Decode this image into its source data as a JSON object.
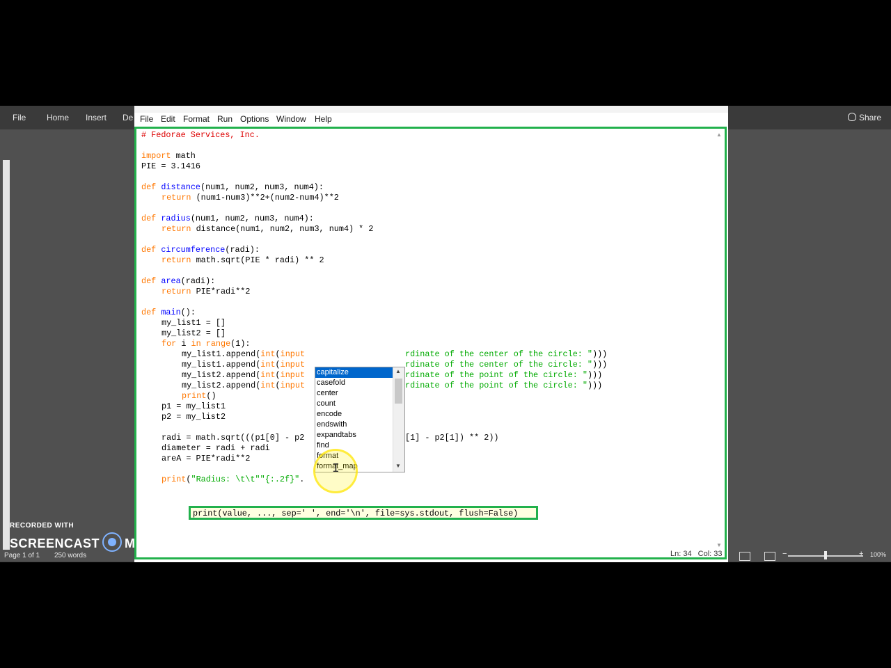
{
  "word": {
    "tabs": [
      "File",
      "Home",
      "Insert",
      "De"
    ],
    "share_label": "Share",
    "status": {
      "page": "Page 1 of 1",
      "words": "250 words"
    },
    "zoom_label": "100%",
    "watermark": {
      "line1": "RECORDED WITH",
      "brand_left": "SCREENCAST",
      "brand_right": "MATIC"
    }
  },
  "idle": {
    "menu": [
      "File",
      "Edit",
      "Format",
      "Run",
      "Options",
      "Window",
      "Help"
    ],
    "status": {
      "line": "Ln: 34",
      "col": "Col: 33"
    },
    "code": {
      "l1": "# Fedorae Services, Inc.",
      "l2_kw": "import",
      "l2_rest": " math",
      "l3": "PIE = 3.1416",
      "l4_kw": "def",
      "l4_fn": "distance",
      "l4_rest": "(num1, num2, num3, num4):",
      "l5_kw": "return",
      "l5_rest": " (num1-num3)**2+(num2-num4)**2",
      "l6_kw": "def",
      "l6_fn": "radius",
      "l6_rest": "(num1, num2, num3, num4):",
      "l7_kw": "return",
      "l7_rest": " distance(num1, num2, num3, num4) * 2",
      "l8_kw": "def",
      "l8_fn": "circumference",
      "l8_rest": "(radi):",
      "l9_kw": "return",
      "l9_rest": " math.sqrt(PIE * radi) ** 2",
      "l10_kw": "def",
      "l10_fn": "area",
      "l10_rest": "(radi):",
      "l11_kw": "return",
      "l11_rest": " PIE*radi**2",
      "l12_kw": "def",
      "l12_fn": "main",
      "l12_rest": "():",
      "l13": "my_list1 = []",
      "l14": "my_list2 = []",
      "l15_kw": "for",
      "l15_a": " i ",
      "l15_kw2": "in",
      "l15_b": " ",
      "l15_bi": "range",
      "l15_c": "(1):",
      "l16_a": "my_list1.append(",
      "l16_bi": "int",
      "l16_b": "(",
      "l16_bi2": "input",
      "l16_str": "rdinate of the center of the circle: \"",
      "l16_end": ")))",
      "l17_a": "my_list1.append(",
      "l17_bi": "int",
      "l17_b": "(",
      "l17_bi2": "input",
      "l17_str": "rdinate of the center of the circle: \"",
      "l17_end": ")))",
      "l18_a": "my_list2.append(",
      "l18_bi": "int",
      "l18_b": "(",
      "l18_bi2": "input",
      "l18_str": "rdinate of the point of the circle: \"",
      "l18_end": ")))",
      "l19_a": "my_list2.append(",
      "l19_bi": "int",
      "l19_b": "(",
      "l19_bi2": "input",
      "l19_str": "rdinate of the point of the circle: \"",
      "l19_end": ")))",
      "l20_bi": "print",
      "l20_rest": "()",
      "l21": "p1 = my_list1",
      "l22": "p2 = my_list2",
      "l23_a": "radi = math.sqrt(((p1[0] - p2",
      "l23_b": "[1] - p2[1]) ** 2))",
      "l24": "diameter = radi + radi",
      "l25": "areA = PIE*radi**2",
      "l26_bi": "print",
      "l26_b": "(",
      "l26_str": "\"Radius: \\t\\t\"\"{:.2f}\"",
      "l26_c": ".",
      "calltip": "print(value, ..., sep=' ', end='\\n', file=sys.stdout, flush=False)"
    },
    "autocomplete": [
      "capitalize",
      "casefold",
      "center",
      "count",
      "encode",
      "endswith",
      "expandtabs",
      "find",
      "format",
      "format_map"
    ]
  },
  "colors": {
    "keyword": "#ff7700",
    "def_name": "#0000ff",
    "string": "#00aa00",
    "comment": "#dd0000",
    "highlight_box": "#22b14c",
    "selection": "#0066cc"
  }
}
